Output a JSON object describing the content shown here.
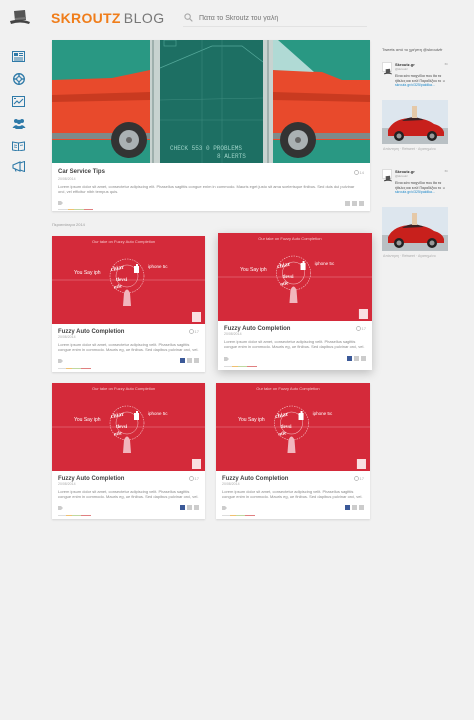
{
  "header": {
    "brand_primary": "SKROUTZ",
    "brand_secondary": "BLOG",
    "search_placeholder": "Πάτα το Skroutz του γαλή"
  },
  "nav": [
    {
      "name": "nav-news-icon"
    },
    {
      "name": "nav-lifebuoy-icon"
    },
    {
      "name": "nav-chart-icon"
    },
    {
      "name": "nav-team-icon"
    },
    {
      "name": "nav-book-icon"
    },
    {
      "name": "nav-megaphone-icon"
    }
  ],
  "featured": {
    "title": "Car Service Tips",
    "date": "20/08/2014",
    "comments": "14",
    "excerpt": "Lorem ipsum dolor sit amet, consectetur adipiscing elit. Phasellus sagittis congue enim in commodo. Mauris eget justo sit ama scelerisque finibus. Sed duis dui pulvinar orci, vel efficitur nibh tempus quis.",
    "screen_line_1": "CHECK 553   0 PROBLEMS",
    "screen_line_2": "8 ALERTS"
  },
  "section_label": "Περισσότερα 2014",
  "grid_posts": [
    {
      "title": "Fuzzy Auto Completion",
      "date": "20/08/2014",
      "comments": "17",
      "excerpt": "Lorem ipsum dolor sit amet, consectetur adipiscing velit. Phasellus sagittis congue enim in commodo. Mauris eg, ue finibus. Sed dapibus pulvinar orci, vel."
    },
    {
      "title": "Fuzzy Auto Completion",
      "date": "20/08/2014",
      "comments": "17",
      "excerpt": "Lorem ipsum dolor sit amet, consectetur adipiscing velit. Phasellus sagittis congue enim in commodo. Mauris eg, ue finibus. Sed dapibus pulvinar orci, vel."
    },
    {
      "title": "Fuzzy Auto Completion",
      "date": "20/08/2014",
      "comments": "17",
      "excerpt": "Lorem ipsum dolor sit amet, consectetur adipiscing velit. Phasellus sagittis congue enim in commodo. Mauris eg, ue finibus. Sed dapibus pulvinar orci, vel."
    },
    {
      "title": "Fuzzy Auto Completion",
      "date": "20/08/2014",
      "comments": "17",
      "excerpt": "Lorem ipsum dolor sit amet, consectetur adipiscing velit. Phasellus sagittis congue enim in commodo. Mauris eg, ue finibus. Sed dapibus pulvinar orci, vel."
    }
  ],
  "poster": {
    "heading": "Our take on Fuzzy Auto Completion",
    "left_word": "You Say iph",
    "right_word": "iphone 5c",
    "center_words": [
      "chiar",
      "tlevsi",
      "ntle"
    ]
  },
  "twitter": {
    "header": "Tweets από το χρήστη @skroutzfr",
    "tweets": [
      {
        "name": "Skroutz.gr",
        "handle": "@skroutz",
        "time": "6h",
        "text": "Είναι κάτι παιχνίδια που θα τα ήθελες και εσύ! Παραδέξου το ",
        "link": "skroutz.gr/c/325/paidika...",
        "actions": "Απάντηση · Retweet · Αγαπημένο"
      },
      {
        "name": "Skroutz.gr",
        "handle": "@skroutz",
        "time": "6h",
        "text": "Είναι κάτι παιχνίδια που θα τα ήθελες και εσύ! Παραδέξου το ",
        "link": "skroutz.gr/c/325/paidika...",
        "actions": "Απάντηση · Retweet · Αγαπημένο"
      }
    ]
  },
  "colors": {
    "brand_orange": "#f07d1a",
    "poster_red": "#d42a3a",
    "teal": "#2a9b86",
    "car_red": "#e84a2c"
  }
}
